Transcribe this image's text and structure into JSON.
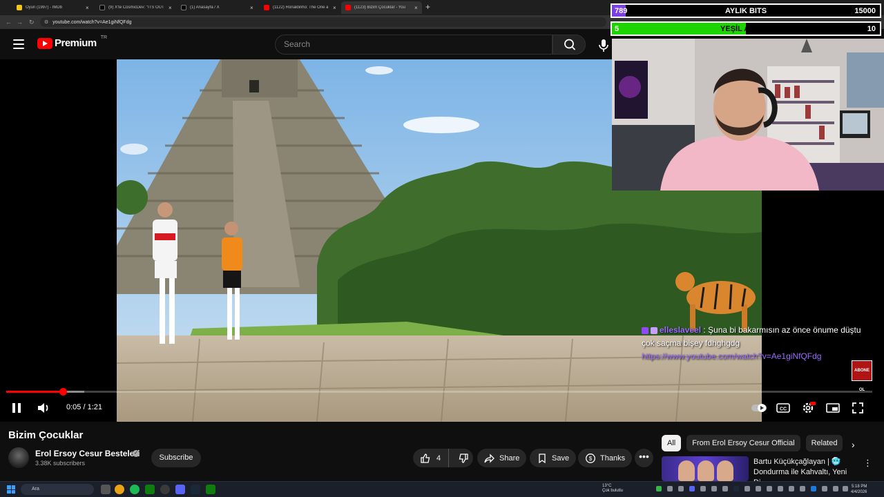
{
  "browser": {
    "tabs": [
      {
        "title": "Oyun (1997) - IMDb",
        "favicon_color": "#f5c518",
        "active": false
      },
      {
        "title": "(9) X'te CosmicDev: \"ITS OUT!! \\",
        "favicon_color": "#000000",
        "active": false
      },
      {
        "title": "(1) Anasayfa / X",
        "favicon_color": "#000000",
        "active": false
      },
      {
        "title": "(1122) Ronaldinho: The One an",
        "favicon_color": "#ff0000",
        "active": false
      },
      {
        "title": "(1123) Bizim Çocuklar - You",
        "favicon_color": "#ff0000",
        "active": true
      }
    ],
    "url": "youtube.com/watch?v=Ae1giNfQFdg"
  },
  "header": {
    "brand": "Premium",
    "country": "TR",
    "search_placeholder": "Search"
  },
  "player": {
    "time_current": "0:05",
    "time_total": "1:21",
    "progress": 0.065,
    "buffered": 0.09,
    "subscribe_overlay": "ABONE OL"
  },
  "stream_overlay": {
    "bits_goal": {
      "current": "789",
      "label": "AYLIK BITS",
      "target": "15000",
      "progress": 0.0526,
      "color": "#7b3fe4"
    },
    "sub_goal": {
      "current": "5",
      "label": "YEŞİL ABONE",
      "target": "10",
      "progress": 0.5,
      "color": "#1ed400"
    },
    "chat": {
      "username": "elleslaveel",
      "message": "Şuna bi bakarmısın az önce önume düştu çok saçma bişey fdhghgdg",
      "link": "https://www.youtube.com/watch?v=Ae1giNfQFdg"
    }
  },
  "video": {
    "title": "Bizim Çocuklar",
    "channel": "Erol Ersoy Cesur Besteleri",
    "subscribers": "3.38K subscribers",
    "subscribe_label": "Subscribe",
    "likes": "4",
    "share_label": "Share",
    "save_label": "Save",
    "thanks_label": "Thanks"
  },
  "sidebar": {
    "chips": [
      "All",
      "From Erol Ersoy Cesur Official",
      "Related"
    ],
    "active_chip": "All",
    "recommendation_title": "Bartu Küçükçağlayan | 🥶 Dondurma ile Kahvaltı, Yeni Di..."
  },
  "taskbar": {
    "search_text": "Ara",
    "weather_temp": "13°C",
    "weather_text": "Çok bulutlu",
    "time": "5:18 PM",
    "date": "4/4/2026"
  }
}
